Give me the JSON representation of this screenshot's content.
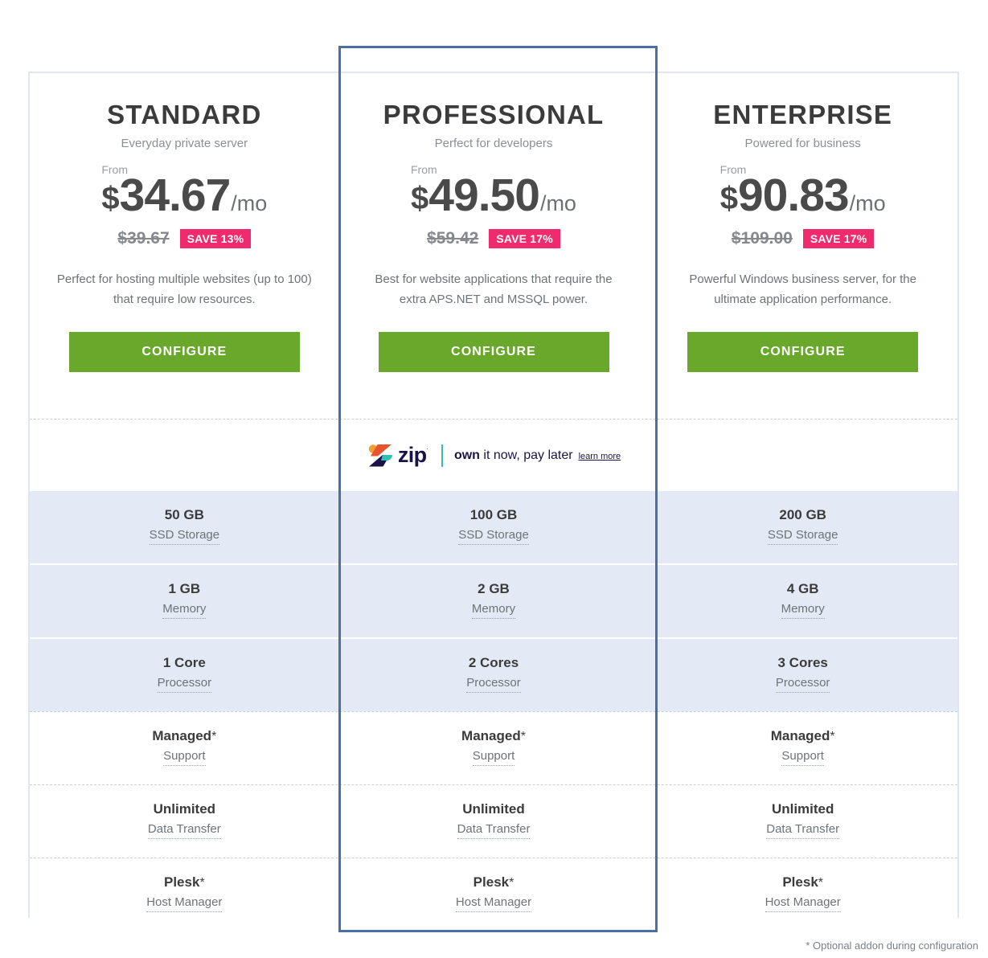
{
  "colors": {
    "accent_green": "#6aa82b",
    "badge_pink": "#ef2b6d",
    "featured_border": "#4c6ea7",
    "card_border": "#dfe6f1",
    "row_shaded": "#e4eaf5",
    "zip_navy": "#1a1446",
    "zip_teal": "#2fbfb4",
    "zip_orange": "#f0a030",
    "zip_red": "#e8542f"
  },
  "plans": [
    {
      "name": "STANDARD",
      "tagline": "Everyday private server",
      "from_label": "From",
      "currency": "$",
      "price": "34.67",
      "period": "/mo",
      "was_price": "$39.67",
      "save_badge": "SAVE 13%",
      "description": "Perfect for hosting multiple websites (up to 100) that require low resources.",
      "cta": "CONFIGURE",
      "featured": false
    },
    {
      "name": "PROFESSIONAL",
      "tagline": "Perfect for developers",
      "from_label": "From",
      "currency": "$",
      "price": "49.50",
      "period": "/mo",
      "was_price": "$59.42",
      "save_badge": "SAVE 17%",
      "description": "Best for website applications that require the extra APS.NET and MSSQL power.",
      "cta": "CONFIGURE",
      "featured": true
    },
    {
      "name": "ENTERPRISE",
      "tagline": "Powered for business",
      "from_label": "From",
      "currency": "$",
      "price": "90.83",
      "period": "/mo",
      "was_price": "$109.00",
      "save_badge": "SAVE 17%",
      "description": "Powerful Windows business server, for the ultimate application performance.",
      "cta": "CONFIGURE",
      "featured": false
    }
  ],
  "zip_banner": {
    "brand": "zip",
    "trademark": "˙",
    "tagline_bold": "own",
    "tagline_rest": " it now, pay later",
    "learn_more": "learn more"
  },
  "features": [
    {
      "label": "SSD Storage",
      "shaded": true,
      "values": [
        "50 GB",
        "100 GB",
        "200 GB"
      ],
      "asterisk": false
    },
    {
      "label": "Memory",
      "shaded": true,
      "values": [
        "1 GB",
        "2 GB",
        "4 GB"
      ],
      "asterisk": false
    },
    {
      "label": "Processor",
      "shaded": true,
      "values": [
        "1 Core",
        "2 Cores",
        "3 Cores"
      ],
      "asterisk": false
    },
    {
      "label": "Support",
      "shaded": false,
      "values": [
        "Managed",
        "Managed",
        "Managed"
      ],
      "asterisk": true
    },
    {
      "label": "Data Transfer",
      "shaded": false,
      "values": [
        "Unlimited",
        "Unlimited",
        "Unlimited"
      ],
      "asterisk": false
    },
    {
      "label": "Host Manager",
      "shaded": false,
      "values": [
        "Plesk",
        "Plesk",
        "Plesk"
      ],
      "asterisk": true
    }
  ],
  "footnote": "* Optional addon during configuration"
}
